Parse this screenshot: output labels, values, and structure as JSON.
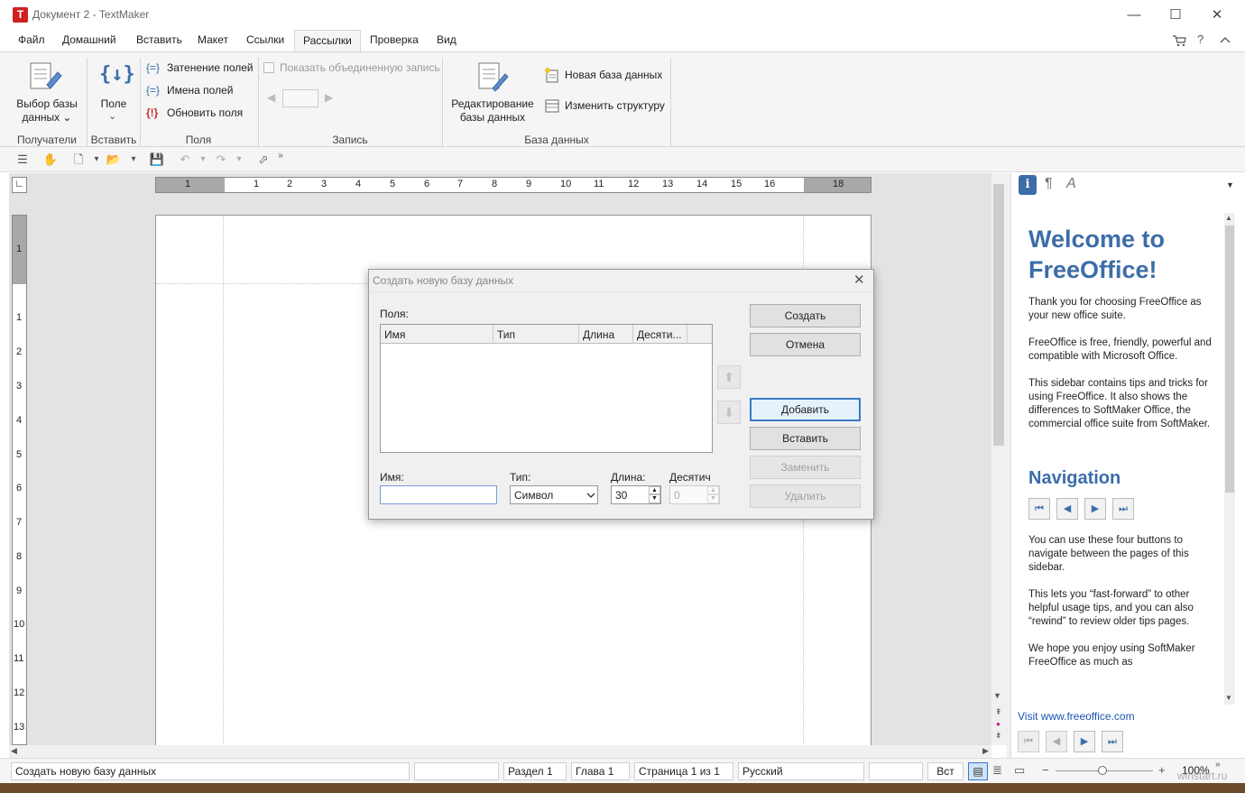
{
  "window": {
    "title": "Документ 2 - TextMaker",
    "app_icon_letter": "T"
  },
  "window_controls": {
    "minimize": "—",
    "maximize": "☐",
    "close": "✕"
  },
  "menu": [
    "Файл",
    "Домашний",
    "Вставить",
    "Макет",
    "Ссылки",
    "Рассылки",
    "Проверка",
    "Вид"
  ],
  "menu_active": "Рассылки",
  "menu_right_icons": [
    "cart-icon",
    "help-icon",
    "collapse-ribbon-icon"
  ],
  "ribbon": {
    "recipients": {
      "button": "Выбор базы данных",
      "group": "Получатели"
    },
    "insert": {
      "button": "Поле",
      "group": "Вставить"
    },
    "fields": {
      "items": [
        "Затенение полей",
        "Имена полей",
        "Обновить поля"
      ],
      "group": "Поля"
    },
    "record": {
      "checkbox": "Показать объединенную запись",
      "group": "Запись"
    },
    "database": {
      "edit_button": "Редактирование базы данных",
      "new_db": "Новая база данных",
      "change_structure": "Изменить структуру",
      "group": "База данных"
    }
  },
  "ruler": {
    "marks": [
      "1",
      "1",
      "2",
      "3",
      "4",
      "5",
      "6",
      "7",
      "8",
      "9",
      "10",
      "11",
      "12",
      "13",
      "14",
      "15",
      "16",
      "18"
    ],
    "vmarks": [
      "1",
      "1",
      "2",
      "3",
      "4",
      "5",
      "6",
      "7",
      "8",
      "9",
      "10",
      "11",
      "12",
      "13"
    ]
  },
  "dialog": {
    "title": "Создать новую базу данных",
    "fields_label": "Поля:",
    "columns": [
      "Имя",
      "Тип",
      "Длина",
      "Десяти..."
    ],
    "buttons": {
      "create": "Создать",
      "cancel": "Отмена",
      "add": "Добавить",
      "insert": "Вставить",
      "replace": "Заменить",
      "delete": "Удалить"
    },
    "name_label": "Имя:",
    "name_value": "",
    "type_label": "Тип:",
    "type_value": "Символ",
    "length_label": "Длина:",
    "length_value": "30",
    "decimal_label": "Десятич",
    "decimal_value": "0"
  },
  "sidebar": {
    "welcome_title": "Welcome to FreeOffice!",
    "p1": "Thank you for choosing FreeOffice as your new office suite.",
    "p2": "FreeOffice is free, friendly, powerful and compatible with Microsoft Office.",
    "p3": "This sidebar contains tips and tricks for using FreeOffice. It also shows the differences to SoftMaker Office, the commercial office suite from SoftMaker.",
    "nav_title": "Navigation",
    "p4": "You can use these four buttons to navigate between the pages of this sidebar.",
    "p5": "This lets you “fast-forward” to other helpful usage tips, and you can also “rewind” to review older tips pages.",
    "p6": "We hope you enjoy using SoftMaker FreeOffice as much as",
    "link": "Visit www.freeoffice.com"
  },
  "status": {
    "message": "Создать новую базу данных",
    "section": "Раздел 1",
    "chapter": "Глава 1",
    "page": "Страница 1 из 1",
    "language": "Русский",
    "mode": "Вст",
    "zoom": "100%",
    "watermark": "winstart.ru"
  }
}
